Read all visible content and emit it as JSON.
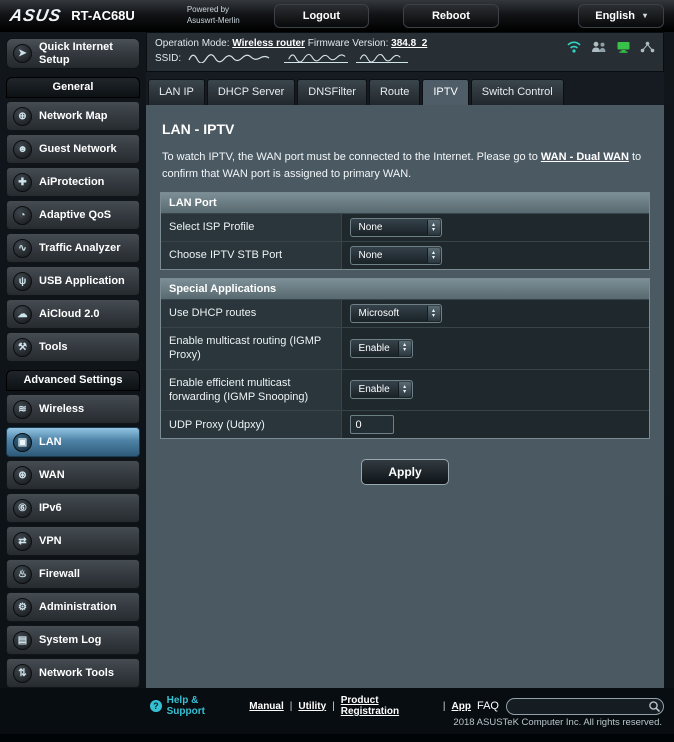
{
  "topbar": {
    "brand": "ASUS",
    "model": "RT-AC68U",
    "powered_by": "Powered by",
    "firmware_name": "Asuswrt-Merlin",
    "logout": "Logout",
    "reboot": "Reboot",
    "language": "English"
  },
  "infobar": {
    "operation_mode_label": "Operation Mode:",
    "operation_mode_value": "Wireless router",
    "firmware_label": "Firmware Version:",
    "firmware_value": "384.8_2",
    "ssid_label": "SSID:"
  },
  "icons": {
    "chevron_down": "▾",
    "stepper_up": "▴",
    "stepper_down": "▾",
    "help": "?"
  },
  "sidebar": {
    "quick_setup": "Quick Internet Setup",
    "active_item": "LAN",
    "sections": [
      {
        "title": "General",
        "items": [
          {
            "label": "Network Map",
            "glyph": "⊕"
          },
          {
            "label": "Guest Network",
            "glyph": "☻"
          },
          {
            "label": "AiProtection",
            "glyph": "✚"
          },
          {
            "label": "Adaptive QoS",
            "glyph": "◔"
          },
          {
            "label": "Traffic Analyzer",
            "glyph": "∿"
          },
          {
            "label": "USB Application",
            "glyph": "ψ"
          },
          {
            "label": "AiCloud 2.0",
            "glyph": "☁"
          },
          {
            "label": "Tools",
            "glyph": "⚒"
          }
        ]
      },
      {
        "title": "Advanced Settings",
        "items": [
          {
            "label": "Wireless",
            "glyph": "≋"
          },
          {
            "label": "LAN",
            "glyph": "▣"
          },
          {
            "label": "WAN",
            "glyph": "⊛"
          },
          {
            "label": "IPv6",
            "glyph": "⑥"
          },
          {
            "label": "VPN",
            "glyph": "⇄"
          },
          {
            "label": "Firewall",
            "glyph": "♨"
          },
          {
            "label": "Administration",
            "glyph": "⚙"
          },
          {
            "label": "System Log",
            "glyph": "▤"
          },
          {
            "label": "Network Tools",
            "glyph": "⇅"
          }
        ]
      }
    ]
  },
  "tabs": {
    "items": [
      "LAN IP",
      "DHCP Server",
      "DNSFilter",
      "Route",
      "IPTV",
      "Switch Control"
    ],
    "active": "IPTV"
  },
  "content": {
    "title": "LAN - IPTV",
    "description_pre": "To watch IPTV, the WAN port must be connected to the Internet. Please go to ",
    "description_link": "WAN - Dual WAN",
    "description_post": " to confirm that WAN port is assigned to primary WAN.",
    "sections": [
      {
        "header": "LAN Port",
        "rows": [
          {
            "label": "Select ISP Profile",
            "control": "select",
            "value": "None"
          },
          {
            "label": "Choose IPTV STB Port",
            "control": "select",
            "value": "None"
          }
        ]
      },
      {
        "header": "Special Applications",
        "rows": [
          {
            "label": "Use DHCP routes",
            "control": "select",
            "value": "Microsoft"
          },
          {
            "label": "Enable multicast routing (IGMP Proxy)",
            "control": "select",
            "value": "Enable"
          },
          {
            "label": "Enable efficient multicast forwarding (IGMP Snooping)",
            "control": "select",
            "value": "Enable"
          },
          {
            "label": "UDP Proxy (Udpxy)",
            "control": "input",
            "value": "0"
          }
        ]
      }
    ],
    "apply": "Apply"
  },
  "footer": {
    "help": "Help & Support",
    "links": [
      "Manual",
      "Utility",
      "Product Registration",
      "App"
    ],
    "separator": "|",
    "faq_label": "FAQ",
    "copyright": "2018 ASUSTeK Computer Inc. All rights reserved."
  }
}
